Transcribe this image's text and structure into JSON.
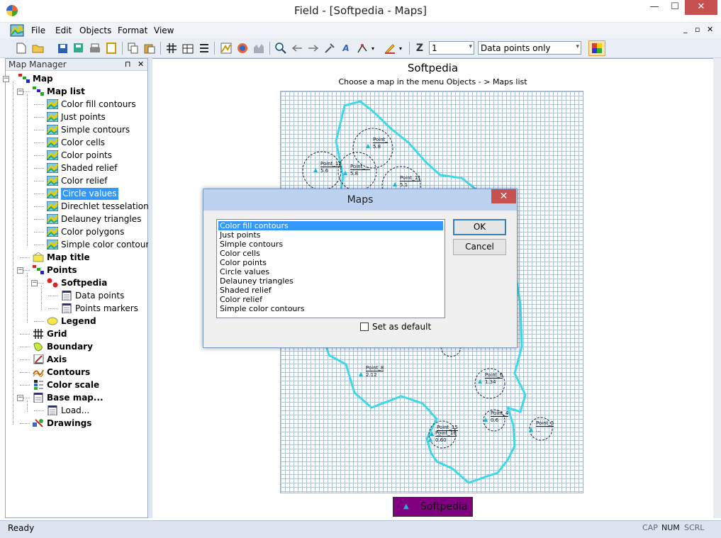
{
  "window": {
    "title": "Field - [Softpedia - Maps]",
    "minimize": "—",
    "maximize": "☐",
    "close": "✕",
    "mdi_minimize": "_",
    "mdi_restore": "▫",
    "mdi_close": "✕"
  },
  "menu": [
    "File",
    "Edit",
    "Objects",
    "Format",
    "View"
  ],
  "toolbar": {
    "z_label": "Z",
    "z_value": "1",
    "mode_value": "Data points only"
  },
  "panel": {
    "title": "Map Manager",
    "pin": "⊓",
    "close": "✕"
  },
  "tree": [
    {
      "label": "Map",
      "bold": true,
      "icon": "map-root-icon"
    },
    {
      "label": "Map list",
      "bold": true,
      "icon": "map-list-icon"
    },
    {
      "label": "Color fill contours",
      "icon": "map-type-icon"
    },
    {
      "label": "Just points",
      "icon": "map-type-icon"
    },
    {
      "label": "Simple contours",
      "icon": "map-type-icon"
    },
    {
      "label": "Color cells",
      "icon": "map-type-icon"
    },
    {
      "label": "Color points",
      "icon": "map-type-icon"
    },
    {
      "label": "Shaded relief",
      "icon": "map-type-icon"
    },
    {
      "label": "Color relief",
      "icon": "map-type-icon"
    },
    {
      "label": "Circle values",
      "icon": "map-type-icon",
      "selected": true
    },
    {
      "label": "Direchlet tesselations",
      "icon": "map-type-icon"
    },
    {
      "label": "Delauney triangles",
      "icon": "map-type-icon"
    },
    {
      "label": "Color polygons",
      "icon": "map-type-icon"
    },
    {
      "label": "Simple color contours",
      "icon": "map-type-icon"
    },
    {
      "label": "Map title",
      "bold": true,
      "icon": "map-title-icon"
    },
    {
      "label": "Points",
      "bold": true,
      "icon": "points-icon"
    },
    {
      "label": "Softpedia",
      "bold": true,
      "icon": "point-set-icon"
    },
    {
      "label": "Data points",
      "icon": "table-icon"
    },
    {
      "label": "Points markers",
      "icon": "table-icon"
    },
    {
      "label": "Legend",
      "bold": true,
      "icon": "legend-icon"
    },
    {
      "label": "Grid",
      "bold": true,
      "icon": "grid-icon"
    },
    {
      "label": "Boundary",
      "bold": true,
      "icon": "boundary-icon"
    },
    {
      "label": "Axis",
      "bold": true,
      "icon": "axis-icon"
    },
    {
      "label": "Contours",
      "bold": true,
      "icon": "contours-icon"
    },
    {
      "label": "Color scale",
      "bold": true,
      "icon": "color-scale-icon"
    },
    {
      "label": "Base map...",
      "bold": true,
      "icon": "base-map-icon"
    },
    {
      "label": "Load...",
      "icon": "table-icon"
    },
    {
      "label": "Drawings",
      "bold": true,
      "icon": "drawings-icon"
    }
  ],
  "map": {
    "title": "Softpedia",
    "subtitle": "Choose a map in the menu Objects - > Maps list",
    "legend_label": "Softpedia",
    "colors": {
      "boundary": "#3fd8e8",
      "grid": "#a9c4dc",
      "legend_bg": "#800080",
      "marker": "#20b8d0"
    }
  },
  "points": [
    {
      "name": "Point_",
      "value": "5.8"
    },
    {
      "name": "Point_...",
      "value": "5.8"
    },
    {
      "name": "Point_12",
      "value": "5.6"
    },
    {
      "name": "Point_11",
      "value": "5.1"
    },
    {
      "name": "Point_8",
      "value": "2.12"
    },
    {
      "name": "Point_6",
      "value": "1.34"
    },
    {
      "name": "Point_4",
      "value": "0.6"
    },
    {
      "name": "Point_5",
      "value": "..."
    },
    {
      "name": "Point_15",
      "value": "..."
    },
    {
      "name": "Point_16",
      "value": "0.60"
    }
  ],
  "dialog": {
    "title": "Maps",
    "close": "✕",
    "options": [
      "Color fill contours",
      "Just points",
      "Simple contours",
      "Color cells",
      "Color points",
      "Circle values",
      "Delauney triangles",
      "Shaded relief",
      "Color relief",
      "Simple color contours"
    ],
    "selected_index": 0,
    "ok": "OK",
    "cancel": "Cancel",
    "checkbox_label": "Set as default",
    "checkbox_checked": false
  },
  "status": {
    "text": "Ready",
    "cap": "CAP",
    "num": "NUM",
    "scrl": "SCRL"
  }
}
